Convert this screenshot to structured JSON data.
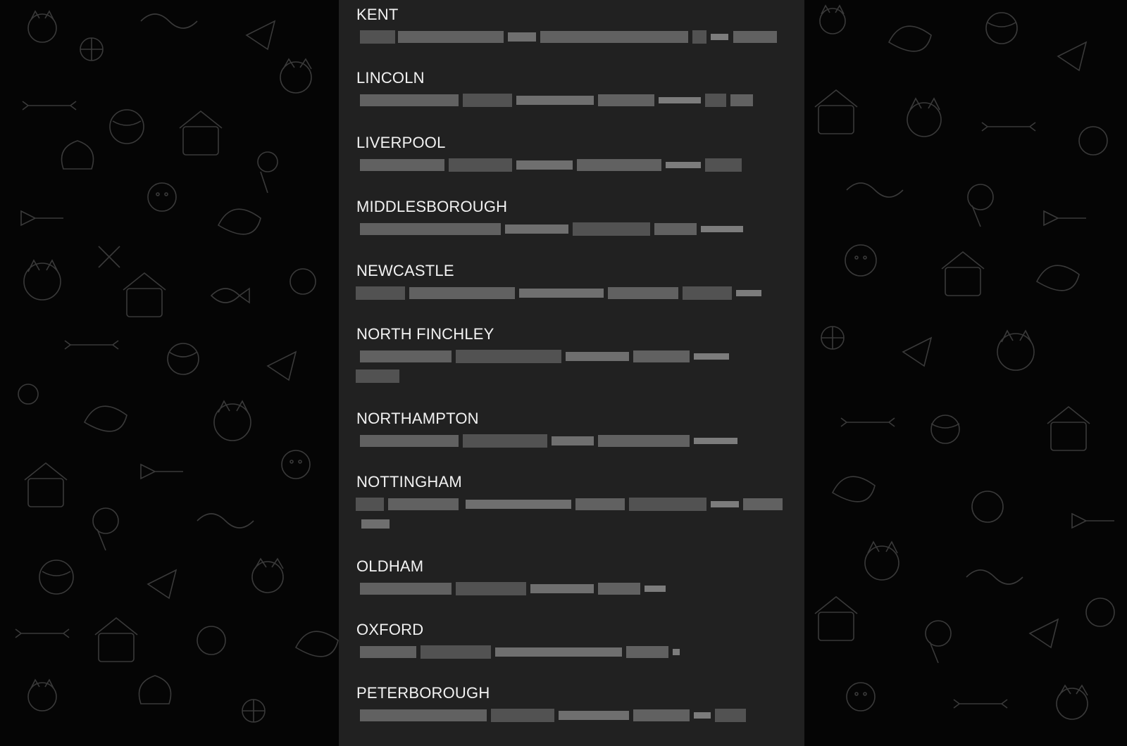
{
  "colors": {
    "panel_background": "#212121",
    "title_text": "#f2f2f2",
    "wallpaper_background": "#050505",
    "wallpaper_doodle": "#3a3a3a"
  },
  "wallpaper": {
    "icons": [
      "cat-doodle-icon",
      "dog-doodle-icon",
      "bone-icon",
      "fish-skeleton-icon",
      "yarn-ball-icon",
      "paper-plane-icon",
      "balloon-icon",
      "dog-house-icon",
      "paw-print-icon",
      "heart-icon"
    ]
  },
  "entries": [
    {
      "title": "KENT"
    },
    {
      "title": "LINCOLN"
    },
    {
      "title": "LIVERPOOL"
    },
    {
      "title": "MIDDLESBOROUGH"
    },
    {
      "title": "NEWCASTLE"
    },
    {
      "title": "NORTH FINCHLEY"
    },
    {
      "title": "NORTHAMPTON"
    },
    {
      "title": "NOTTINGHAM"
    },
    {
      "title": "OLDHAM"
    },
    {
      "title": "OXFORD"
    },
    {
      "title": "PETERBOROUGH"
    }
  ]
}
